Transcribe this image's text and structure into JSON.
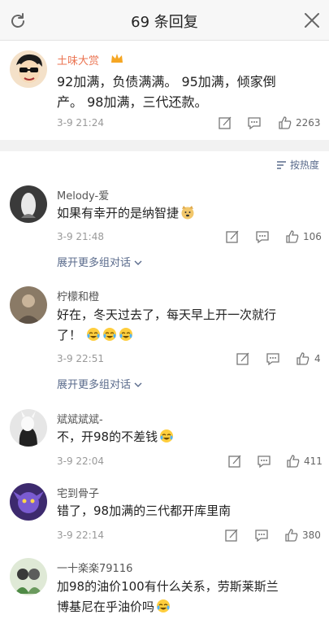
{
  "header": {
    "title": "69 条回复"
  },
  "pinned": {
    "name": "土味大赏",
    "text_line1": "92加满，负债满满。 95加满，倾家倒",
    "text_line2": "产。 98加满，三代还款。",
    "time": "3-9 21:24",
    "likes": "2263"
  },
  "sort_label": "按热度",
  "comments": [
    {
      "name": "Melody-爱",
      "text_line1": "如果有幸开的是纳智捷",
      "time": "3-9 21:48",
      "likes": "106",
      "more": "展开更多组对话"
    },
    {
      "name": "柠檬和橙",
      "text_line1": "好在，冬天过去了，每天早上开一次就行",
      "text_line2": "了！",
      "time": "3-9 22:51",
      "likes": "4",
      "more": "展开更多组对话"
    },
    {
      "name": "斌斌斌斌-",
      "text_line1": "不，开98的不差钱",
      "time": "3-9 22:04",
      "likes": "411"
    },
    {
      "name": "宅到骨子",
      "text_line1": "错了，98加满的三代都开库里南",
      "time": "3-9 22:14",
      "likes": "380"
    },
    {
      "name": "一十楽楽79116",
      "text_line1": "加98的油价100有什么关系，劳斯莱斯兰",
      "text_line2": "博基尼在乎油价吗"
    }
  ]
}
